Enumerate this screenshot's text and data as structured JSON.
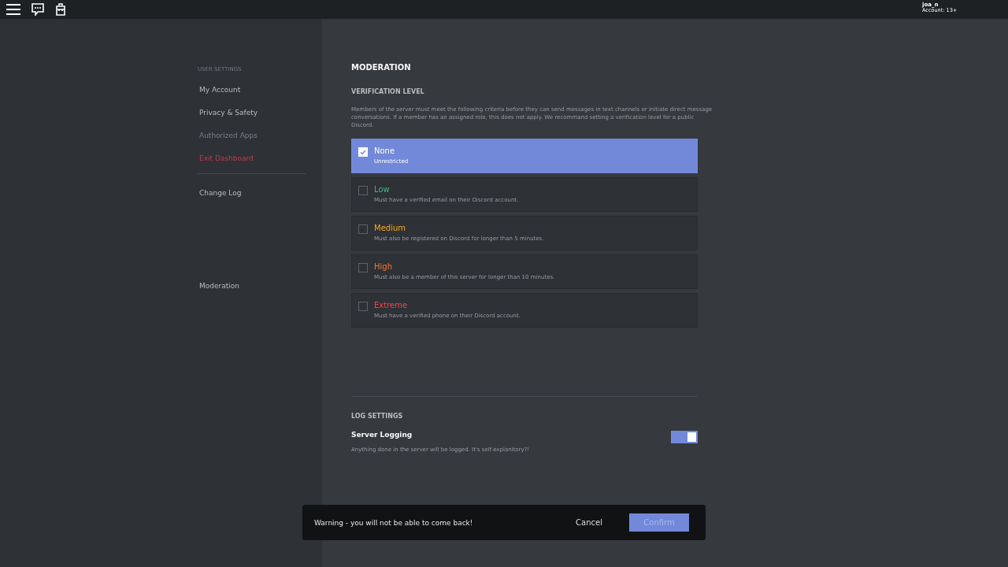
{
  "account": {
    "name": "joa_n",
    "tag": "Account: 13+"
  },
  "sidebar": {
    "header": "USER SETTINGS",
    "items": [
      {
        "label": "My Account",
        "kind": "normal"
      },
      {
        "label": "Privacy & Safety",
        "kind": "normal"
      },
      {
        "label": "Authorized Apps",
        "kind": "disabled"
      },
      {
        "label": "Exit Dashboard",
        "kind": "danger"
      }
    ],
    "after_divider": [
      {
        "label": "Change Log"
      }
    ],
    "server_items": [
      {
        "label": "Moderation"
      }
    ]
  },
  "moderation": {
    "title": "MODERATION",
    "subtitle": "VERIFICATION LEVEL",
    "description": "Members of the server must meet the following criteria before they can send messages in text channels or initiate direct message conversations. If a member has an assigned role, this does not apply. We recommand setting a verification level for a public Discord.",
    "levels": [
      {
        "name": "None",
        "detail": "Unrestricted",
        "selected": true,
        "color": "#ffffff"
      },
      {
        "name": "Low",
        "detail": "Must have a verified email on their Discord account.",
        "selected": false,
        "color": "#43b581"
      },
      {
        "name": "Medium",
        "detail": "Must also be registered on Discord for longer than 5 minutes.",
        "selected": false,
        "color": "#faa61a"
      },
      {
        "name": "High",
        "detail": "Must also be a member of this server for longer than 10 minutes.",
        "selected": false,
        "color": "#f57731"
      },
      {
        "name": "Extreme",
        "detail": "Must have a verified phone on their Discord account.",
        "selected": false,
        "color": "#f04747"
      }
    ]
  },
  "log_settings": {
    "title": "LOG SETTINGS",
    "items": [
      {
        "name": "Server Logging",
        "detail": "Anything done in the server will be logged. It's self-explanitory?!",
        "on": true
      }
    ]
  },
  "toast": {
    "message": "Warning - you will not be able to come back!",
    "cancel": "Cancel",
    "confirm": "Confirm"
  }
}
